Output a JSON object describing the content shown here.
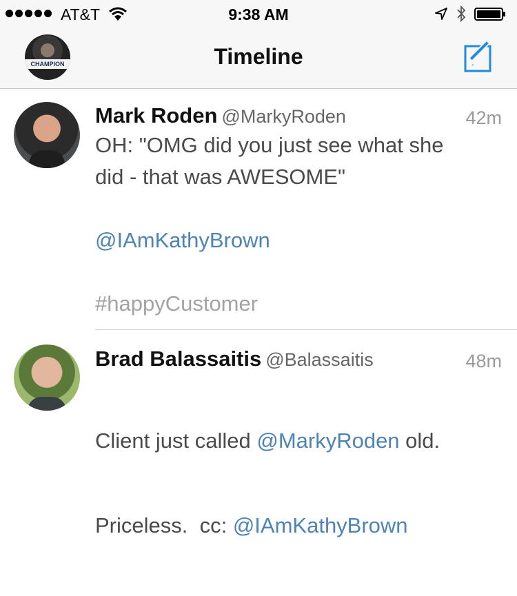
{
  "status_bar": {
    "carrier": "AT&T",
    "time": "9:38 AM",
    "icons": [
      "signal-dots-icon",
      "wifi-icon",
      "location-arrow-icon",
      "bluetooth-icon",
      "battery-icon"
    ]
  },
  "nav": {
    "title": "Timeline",
    "profile_badge_text": "CHAMPION",
    "compose_icon": "compose-icon",
    "accent_color": "#1d8ce0"
  },
  "tweets": [
    {
      "name": "Mark Roden",
      "handle": "@MarkyRoden",
      "time": "42m",
      "text_1": "OH: \"OMG did you just see what she",
      "text_2": "did - that was AWESOME\"",
      "mention": "@IAmKathyBrown",
      "hashtag": "#happyCustomer"
    },
    {
      "name": "Brad Balassaitis",
      "handle": "@Balassaitis",
      "time": "48m",
      "text_1_pre": "Client just called ",
      "text_1_mention": "@MarkyRoden",
      "text_1_post": " old.",
      "text_2_pre": "Priceless.  cc: ",
      "text_2_mention": "@IAmKathyBrown"
    }
  ],
  "colors": {
    "link": "#4d83b6",
    "hashtag": "#a3a3a3",
    "body_text": "#4a4a4a"
  }
}
